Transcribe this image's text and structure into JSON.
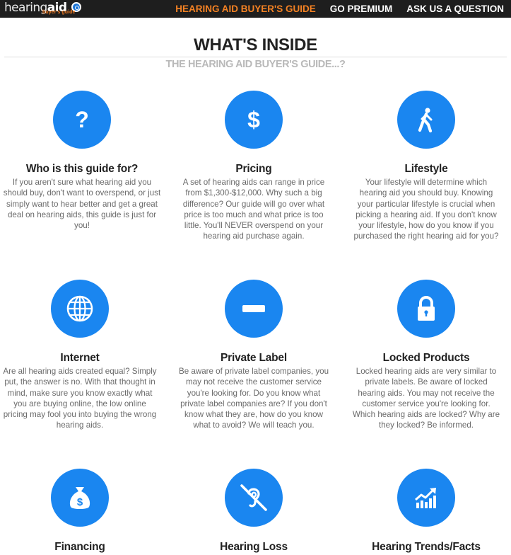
{
  "brand": {
    "logo_light": "hearing",
    "logo_bold": "aid",
    "logo_sub": "buyer's guide"
  },
  "nav": {
    "items": [
      {
        "label": "HEARING AID BUYER'S GUIDE",
        "active": true
      },
      {
        "label": "GO PREMIUM",
        "active": false
      },
      {
        "label": "ASK US A QUESTION",
        "active": false
      }
    ]
  },
  "section": {
    "title": "WHAT'S INSIDE",
    "subtitle": "THE HEARING AID BUYER'S GUIDE...?"
  },
  "features": [
    {
      "icon": "question-icon",
      "title": "Who is this guide for?",
      "text": "If you aren't sure what hearing aid you should buy, don't want to overspend, or just simply want to hear better and get a great deal on hearing aids, this guide is just for you!"
    },
    {
      "icon": "dollar-icon",
      "title": "Pricing",
      "text": "A set of hearing aids can range in price from $1,300-$12,000.  Why such a big difference?  Our guide will go over what price is too much and what price is too little.  You'll NEVER overspend on your hearing aid purchase again."
    },
    {
      "icon": "walking-person-icon",
      "title": "Lifestyle",
      "text": "Your lifestyle will determine which hearing aid you should buy.  Knowing your particular lifestyle is crucial when picking a hearing aid.  If you don't know your lifestyle, how do you know if you purchased the right hearing aid for you?"
    },
    {
      "icon": "globe-icon",
      "title": "Internet",
      "text": "Are all hearing aids created equal? Simply put, the answer is no.  With that thought in mind, make sure you know exactly what you are buying online, the low online pricing may fool you into buying the wrong hearing aids."
    },
    {
      "icon": "minus-icon",
      "title": "Private Label",
      "text": "Be aware of private label companies, you may not receive the customer service you're looking for.  Do you know what private label companies are?  If you don't know what they are, how do you know what to avoid?  We will teach you."
    },
    {
      "icon": "lock-icon",
      "title": "Locked Products",
      "text": "Locked hearing aids are very similar to private labels.  Be aware of locked hearing aids.  You  may not receive the customer service you're looking for.  Which hearing aids are locked?  Why are they locked?  Be informed."
    },
    {
      "icon": "money-bag-icon",
      "title": "Financing",
      "text": ""
    },
    {
      "icon": "hearing-loss-icon",
      "title": "Hearing Loss",
      "text": ""
    },
    {
      "icon": "trend-chart-icon",
      "title": "Hearing Trends/Facts",
      "text": ""
    }
  ],
  "colors": {
    "nav_background": "#1e1e1e",
    "nav_active": "#f58223",
    "icon_circle": "#1a86f0",
    "subtitle": "#b9b9b9",
    "body_text": "#6a6a6a"
  }
}
